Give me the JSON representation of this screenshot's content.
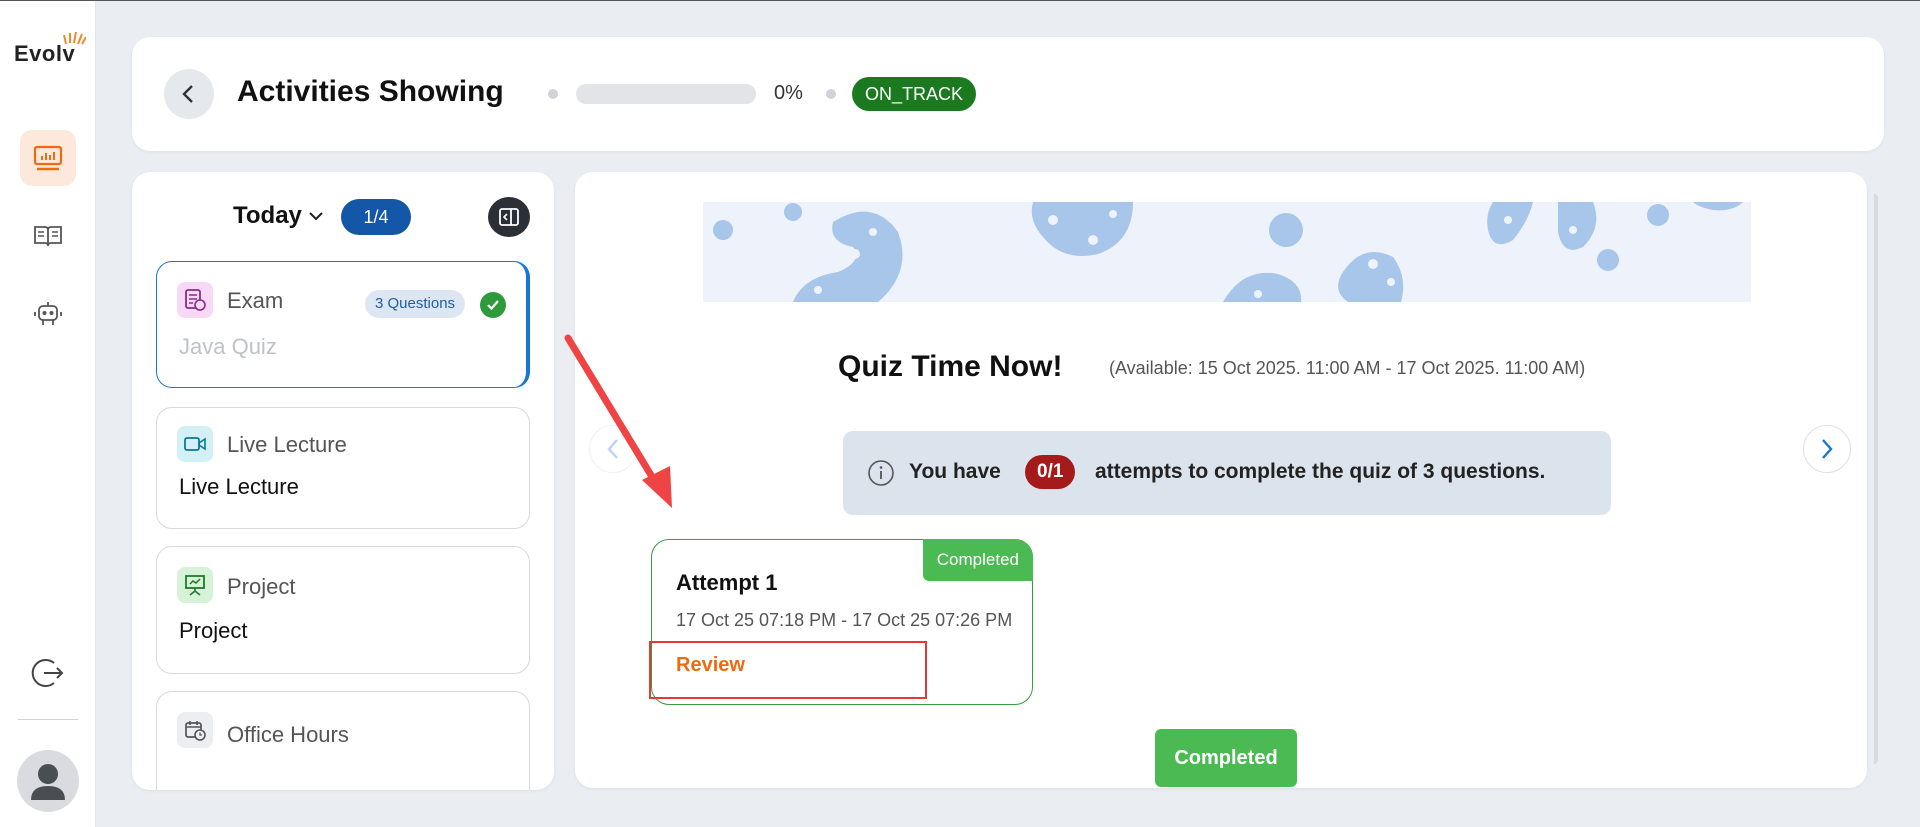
{
  "app": {
    "logo": "Evolv"
  },
  "header": {
    "title": "Activities Showing",
    "progress_value": 0,
    "progress_label": "0%",
    "status_badge": "ON_TRACK",
    "status_color": "#1b7a1f"
  },
  "sidebar_icons": [
    "dashboard-icon",
    "book-icon",
    "robot-icon",
    "logout-icon",
    "user-avatar-icon"
  ],
  "activities": {
    "filter_label": "Today",
    "count": "1/4",
    "items": [
      {
        "type": "Exam",
        "name": "Java Quiz",
        "badge": "3 Questions",
        "icon": "exam-icon",
        "completed": true,
        "selected": true
      },
      {
        "type": "Live Lecture",
        "name": "Live Lecture",
        "icon": "video-icon"
      },
      {
        "type": "Project",
        "name": "Project",
        "icon": "presentation-icon"
      },
      {
        "type": "Office Hours",
        "name": "",
        "icon": "calendar-clock-icon"
      }
    ]
  },
  "quiz": {
    "title": "Quiz Time Now!",
    "availability": "(Available: 15 Oct 2025. 11:00 AM - 17 Oct 2025. 11:00 AM)",
    "attempts_prefix": "You have",
    "attempts_count": "0/1",
    "attempts_suffix": "attempts to complete the quiz of 3 questions.",
    "attempt": {
      "badge": "Completed",
      "title": "Attempt 1",
      "time": "17 Oct 25 07:18 PM - 17 Oct 25 07:26 PM",
      "review_label": "Review"
    },
    "status_button": "Completed"
  },
  "colors": {
    "accent": "#1976d2",
    "success": "#4cba53",
    "danger": "#a51b1b",
    "review": "#ee6b12"
  }
}
